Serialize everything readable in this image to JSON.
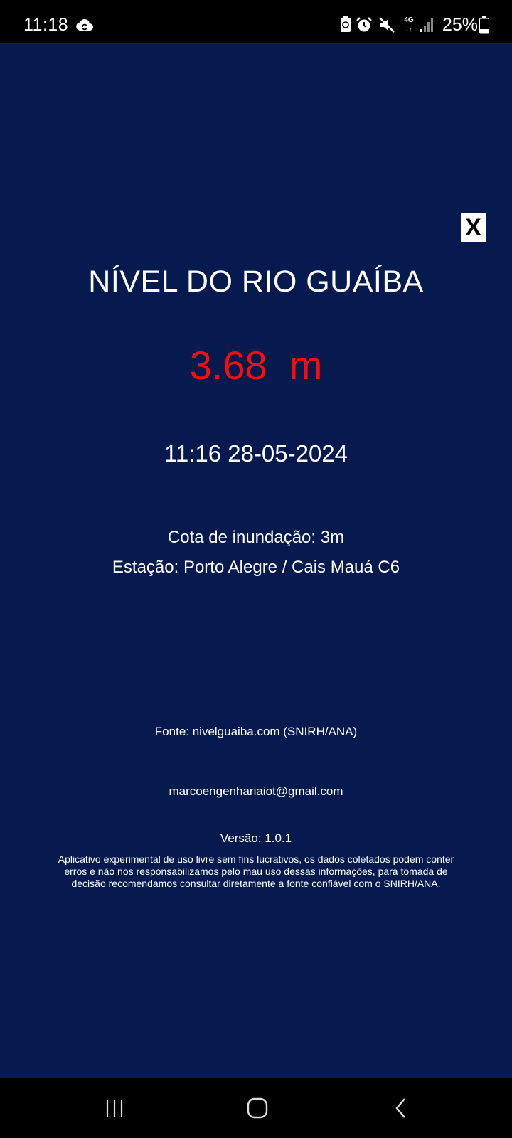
{
  "status_bar": {
    "time": "11:18",
    "network": "4G",
    "battery_percent": "25%",
    "icons": [
      "cloud-sync-icon",
      "battery-saver-icon",
      "alarm-icon",
      "mute-icon",
      "network-4g-icon",
      "signal-icon",
      "battery-icon"
    ]
  },
  "app": {
    "close_label": "X",
    "title": "NÍVEL DO RIO GUAÍBA",
    "level": "3.68  m",
    "level_color": "#ff0a0a",
    "background_color": "#061a50",
    "datetime": "11:16 28-05-2024",
    "flood_quota": "Cota de inundação: 3m",
    "station": "Estação: Porto Alegre / Cais Mauá C6",
    "source": "Fonte: nivelguaiba.com (SNIRH/ANA)",
    "email": "marcoengenhariaiot@gmail.com",
    "version": "Versão: 1.0.1",
    "disclaimer": "Aplicativo experimental de uso livre sem fins lucrativos, os dados coletados podem conter erros e não nos responsabilizamos pelo mau uso dessas informações, para tomada de decisão recomendamos consultar diretamente a fonte confiável com o SNIRH/ANA."
  },
  "nav_bar": {
    "icons": [
      "recent-apps-icon",
      "home-icon",
      "back-icon"
    ]
  }
}
